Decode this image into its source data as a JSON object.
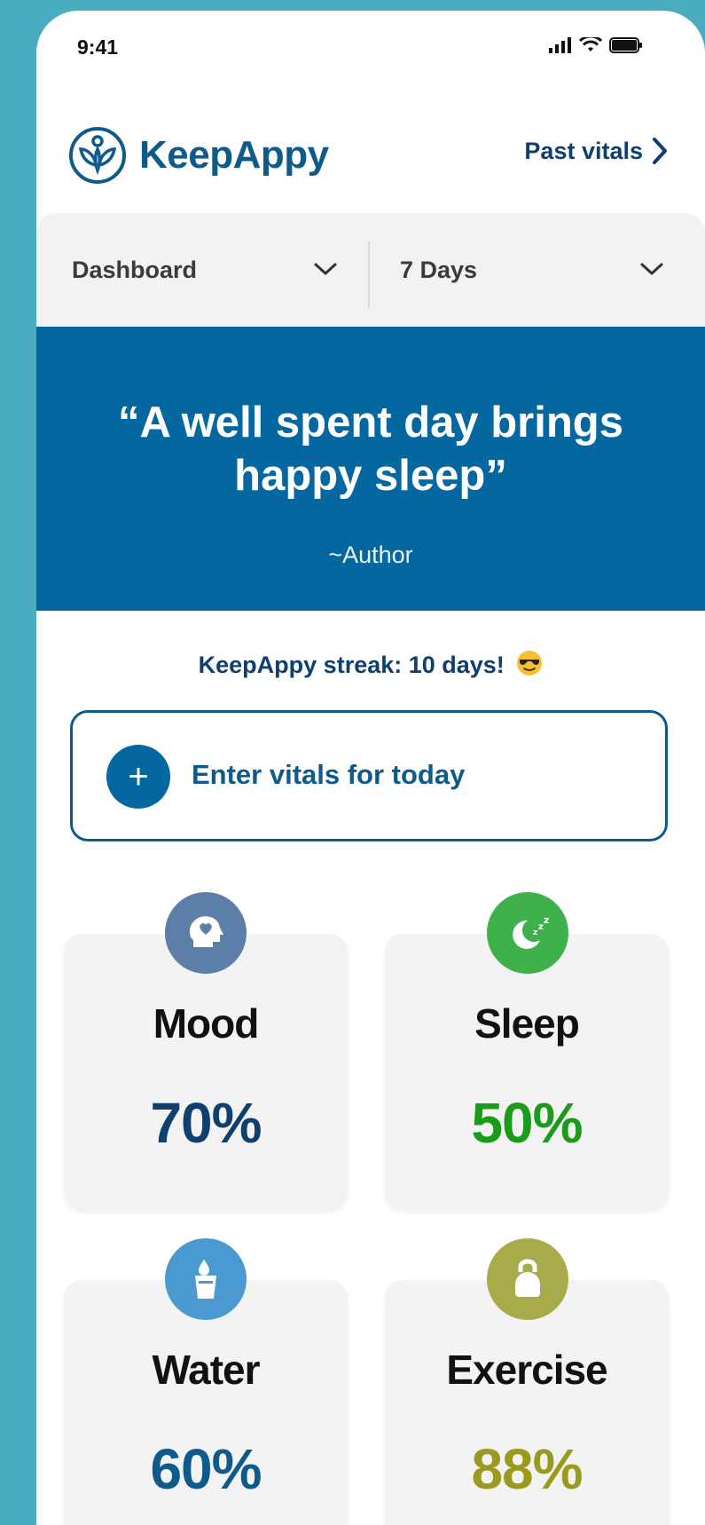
{
  "status_bar": {
    "time": "9:41"
  },
  "header": {
    "brand": "KeepAppy",
    "past_vitals_label": "Past vitals"
  },
  "filters": {
    "view_label": "Dashboard",
    "range_label": "7 Days"
  },
  "quote": {
    "text": "“A well spent day brings happy sleep”",
    "author": "~Author"
  },
  "streak": {
    "text": "KeepAppy streak: 10 days!"
  },
  "enter_vitals": {
    "label": "Enter vitals for today"
  },
  "cards": [
    {
      "title": "Mood",
      "value": "70%",
      "color": "#0e3f6e",
      "icon": "head-heart-icon",
      "icon_bg": "#5b7fa6"
    },
    {
      "title": "Sleep",
      "value": "50%",
      "color": "#1a9c1a",
      "icon": "moon-zzz-icon",
      "icon_bg": "#3fb14a"
    },
    {
      "title": "Water",
      "value": "60%",
      "color": "#0e5a8a",
      "icon": "water-glass-icon",
      "icon_bg": "#4a9ad1"
    },
    {
      "title": "Exercise",
      "value": "88%",
      "color": "#9a9a1f",
      "icon": "kettlebell-icon",
      "icon_bg": "#a7ab4a"
    }
  ]
}
